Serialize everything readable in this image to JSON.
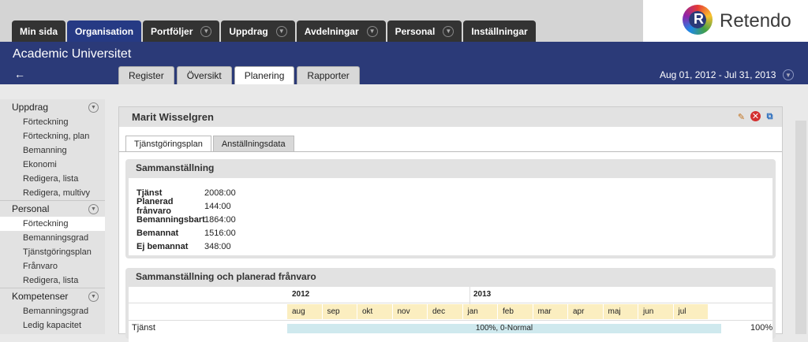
{
  "nav": {
    "tabs": [
      {
        "label": "Min sida",
        "chevron": false,
        "active": false
      },
      {
        "label": "Organisation",
        "chevron": false,
        "active": true
      },
      {
        "label": "Portföljer",
        "chevron": true,
        "active": false
      },
      {
        "label": "Uppdrag",
        "chevron": true,
        "active": false
      },
      {
        "label": "Avdelningar",
        "chevron": true,
        "active": false
      },
      {
        "label": "Personal",
        "chevron": true,
        "active": false
      },
      {
        "label": "Inställningar",
        "chevron": false,
        "active": false
      }
    ],
    "logo_text": "Retendo"
  },
  "header": {
    "org": "Academic Universitet",
    "subtabs": [
      {
        "label": "Register",
        "active": false
      },
      {
        "label": "Översikt",
        "active": false
      },
      {
        "label": "Planering",
        "active": true
      },
      {
        "label": "Rapporter",
        "active": false
      }
    ],
    "date_range": "Aug 01, 2012 - Jul 31, 2013"
  },
  "sidebar": {
    "groups": [
      {
        "label": "Uppdrag",
        "items": [
          "Förteckning",
          "Förteckning, plan",
          "Bemanning",
          "Ekonomi",
          "Redigera, lista",
          "Redigera, multivy"
        ]
      },
      {
        "label": "Personal",
        "items": [
          "Förteckning",
          "Bemanningsgrad",
          "Tjänstgöringsplan",
          "Frånvaro",
          "Redigera, lista"
        ]
      },
      {
        "label": "Kompetenser",
        "items": [
          "Bemanningsgrad",
          "Ledig kapacitet"
        ]
      }
    ],
    "active_item": "Personal.Förteckning"
  },
  "panel": {
    "title": "Marit Wisselgren",
    "tabs": [
      {
        "label": "Tjänstgöringsplan",
        "active": true
      },
      {
        "label": "Anställningsdata",
        "active": false
      }
    ],
    "summary": {
      "title": "Sammanställning",
      "rows": [
        {
          "label": "Tjänst",
          "value": "2008:00"
        },
        {
          "label": "Planerad frånvaro",
          "value": "144:00"
        },
        {
          "label": "Bemanningsbart",
          "value": "1864:00"
        },
        {
          "label": "Bemannat",
          "value": "1516:00"
        },
        {
          "label": "Ej bemannat",
          "value": "348:00"
        }
      ]
    },
    "timeline": {
      "title": "Sammanställning och planerad frånvaro",
      "years": [
        "2012",
        "2013"
      ],
      "months": [
        "aug",
        "sep",
        "okt",
        "nov",
        "dec",
        "jan",
        "feb",
        "mar",
        "apr",
        "maj",
        "jun",
        "jul"
      ],
      "row_label": "Tjänst",
      "bar_text": "100%, 0-Normal",
      "total": "100%"
    }
  },
  "colors": {
    "nav_dark": "#333333",
    "nav_active": "#263a84",
    "header": "#2b3a78",
    "month_bg": "#fbeec0",
    "bar": "#cfe9ee"
  }
}
